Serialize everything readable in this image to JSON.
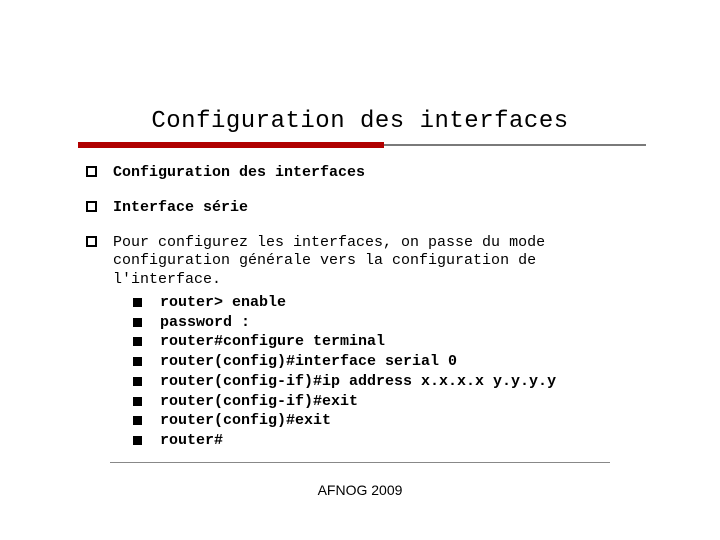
{
  "title": "Configuration des interfaces",
  "bullets": {
    "b1": "Configuration des interfaces",
    "b2": "Interface série",
    "b3_intro": "Pour configurez les interfaces, on passe du mode configuration générale vers la configuration de l'interface."
  },
  "commands": {
    "c1": "router> enable",
    "c2": "password :",
    "c3": "router#configure terminal",
    "c4": "router(config)#interface serial 0",
    "c5": "router(config-if)#ip address x.x.x.x  y.y.y.y",
    "c6": "router(config-if)#exit",
    "c7": "router(config)#exit",
    "c8": "router#"
  },
  "footer": "AFNOG 2009"
}
